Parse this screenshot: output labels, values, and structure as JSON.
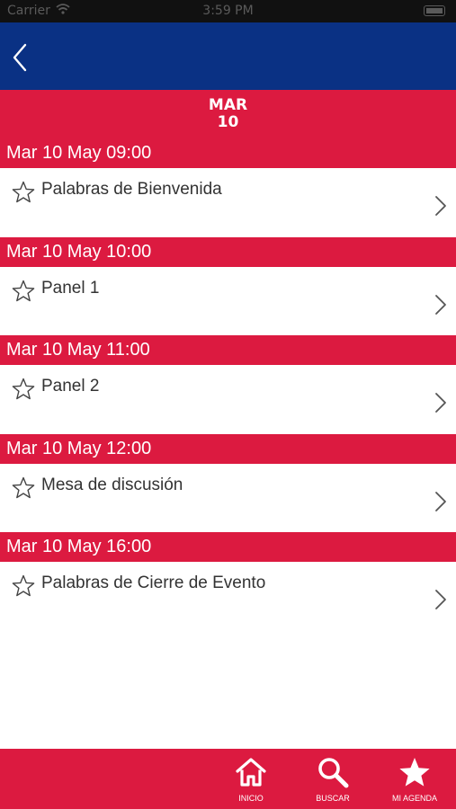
{
  "status_bar": {
    "carrier": "Carrier",
    "time": "3:59 PM"
  },
  "day_header": {
    "weekday": "MAR",
    "day": "10"
  },
  "sessions": [
    {
      "time": "Mar 10 May 09:00",
      "title": "Palabras de Bienvenida"
    },
    {
      "time": "Mar 10 May 10:00",
      "title": "Panel 1"
    },
    {
      "time": "Mar 10 May 11:00",
      "title": "Panel 2"
    },
    {
      "time": "Mar 10 May 12:00",
      "title": "Mesa de discusión"
    },
    {
      "time": "Mar 10 May 16:00",
      "title": "Palabras de Cierre de Evento"
    }
  ],
  "tabs": [
    {
      "label": "INICIO",
      "icon": "home-icon"
    },
    {
      "label": "BUSCAR",
      "icon": "search-icon"
    },
    {
      "label": "MI AGENDA",
      "icon": "star-icon"
    }
  ],
  "colors": {
    "navy": "#0a3184",
    "red": "#dc1a40",
    "white": "#ffffff"
  }
}
